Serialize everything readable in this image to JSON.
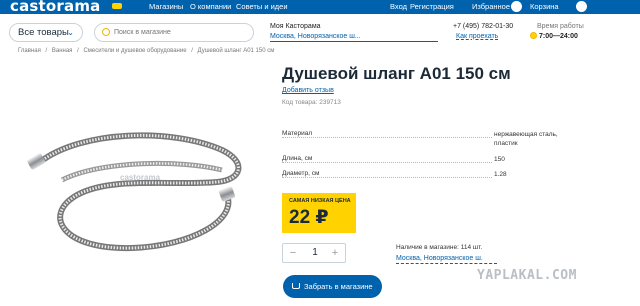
{
  "header": {
    "logo": "castorama",
    "nav": [
      "Магазины",
      "О компании",
      "Советы и идеи"
    ],
    "login": "Вход",
    "register": "Регистрация",
    "favorites": "Избранное",
    "favorites_count": "0",
    "cart": "Корзина",
    "cart_count": "0",
    "accent": "#0061ad",
    "brand_yellow": "#ffd200"
  },
  "subheader": {
    "all_goods": "Все товары",
    "search_placeholder": "Поиск в магазине",
    "my_store_label": "Моя Касторама",
    "my_store_value": "Москва, Новорязанское ш...",
    "phone": "+7 (495) 782-01-30",
    "route": "Как проехать",
    "hours_label": "Время работы",
    "hours": "7:00—24:00"
  },
  "breadcrumb": [
    "Главная",
    "/",
    "Ванная",
    "/",
    "Смесители и душевое оборудование",
    "/",
    "Душевой шланг А01 150 см"
  ],
  "product": {
    "title": "Душевой шланг А01 150 см",
    "review_link": "Добавить отзыв",
    "code": "Код товара: 239713",
    "image_watermark": "castorama",
    "specs": [
      {
        "label": "Материал",
        "value": "нержавеющая сталь, пластик"
      },
      {
        "label": "Длина, см",
        "value": "150"
      },
      {
        "label": "Диаметр, см",
        "value": "1.28"
      }
    ],
    "price_tag": "САМАЯ НИЗКАЯ ЦЕНА",
    "price": "22 ₽",
    "quantity": "1",
    "stock": "Наличие в магазине: 114 шт.",
    "store": "Москва, Новорязанское ш.",
    "buy_button": "Забрать в магазине"
  },
  "watermark": "YAPLAKAL.COM"
}
